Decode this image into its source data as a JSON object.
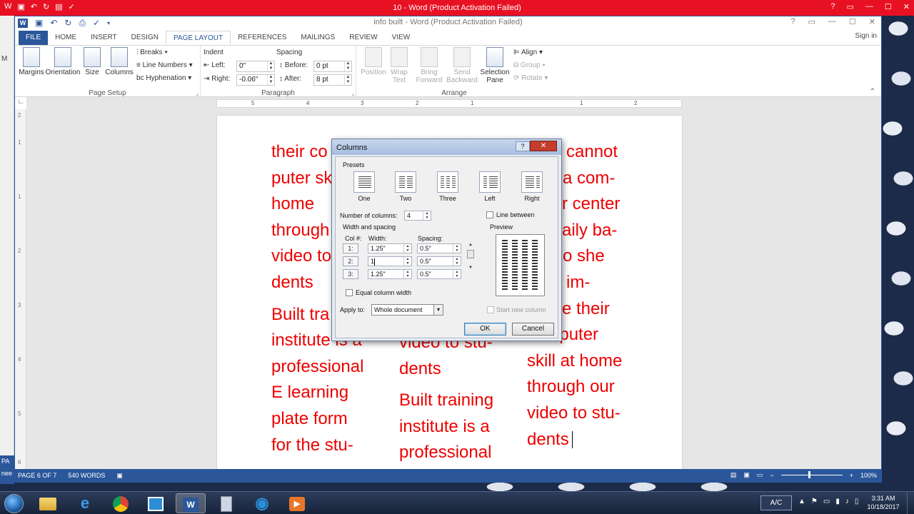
{
  "back_window": {
    "title": "10 -  Word (Product Activation Failed)",
    "left_labels": [
      "M",
      "PA",
      "nee"
    ],
    "colors": {
      "titlebar": "#e81123"
    }
  },
  "window": {
    "title": "info built - Word (Product Activation Failed)",
    "signin": "Sign in",
    "controls": {
      "help": "?",
      "restore_ribbon": "▭",
      "minimize": "—",
      "maximize": "☐",
      "close": "✕"
    }
  },
  "tabs": [
    "FILE",
    "HOME",
    "INSERT",
    "DESIGN",
    "PAGE LAYOUT",
    "REFERENCES",
    "MAILINGS",
    "REVIEW",
    "VIEW"
  ],
  "active_tab": "PAGE LAYOUT",
  "ribbon": {
    "page_setup": {
      "label": "Page Setup",
      "margins": "Margins",
      "orientation": "Orientation",
      "size": "Size",
      "columns": "Columns",
      "breaks": "Breaks",
      "line_numbers": "Line Numbers",
      "hyphenation": "Hyphenation"
    },
    "paragraph": {
      "label": "Paragraph",
      "indent": "Indent",
      "spacing": "Spacing",
      "left_label": "Left:",
      "left_value": "0\"",
      "right_label": "Right:",
      "right_value": "-0.06\"",
      "before_label": "Before:",
      "before_value": "0 pt",
      "after_label": "After:",
      "after_value": "8 pt"
    },
    "arrange": {
      "label": "Arrange",
      "position": "Position",
      "wrap_text_1": "Wrap",
      "wrap_text_2": "Text",
      "bring_forward_1": "Bring",
      "bring_forward_2": "Forward",
      "send_backward_1": "Send",
      "send_backward_2": "Backward",
      "selection_pane_1": "Selection",
      "selection_pane_2": "Pane",
      "align": "Align",
      "group": "Group",
      "rotate": "Rotate"
    }
  },
  "ruler": {
    "numbers": [
      "5",
      "4",
      "3",
      "2",
      "1",
      "1",
      "2"
    ],
    "vertical": [
      "2",
      "1",
      "1",
      "2",
      "3",
      "4",
      "5",
      "6",
      "7",
      "8"
    ]
  },
  "document": {
    "col1": [
      "their co",
      "puter sk",
      "home",
      "through",
      "video to",
      "dents",
      "Built tra",
      "institute is a",
      "professional",
      "E learning",
      "plate form",
      "for the stu-"
    ],
    "col2": [
      "video to stu-",
      "dents",
      "Built training",
      "institute is a",
      "professional"
    ],
    "col3": [
      "cannot",
      "a com-",
      "r center",
      "aily ba-",
      "o she",
      "im-",
      "e their",
      "computer",
      "skill at home",
      "through our",
      "video to stu-",
      "dents"
    ]
  },
  "dialog": {
    "title": "Columns",
    "help": "?",
    "close": "✕",
    "presets_label": "Presets",
    "presets": [
      "One",
      "Two",
      "Three",
      "Left",
      "Right"
    ],
    "number_of_columns_label": "Number of columns:",
    "number_of_columns": "4",
    "line_between": "Line between",
    "width_spacing_label": "Width and spacing",
    "preview_label": "Preview",
    "col_header": "Col #:",
    "width_header": "Width:",
    "spacing_header": "Spacing:",
    "rows": [
      {
        "col": "1:",
        "width": "1.25\"",
        "spacing": "0.5\""
      },
      {
        "col": "2:",
        "width": "1",
        "spacing": "0.5\""
      },
      {
        "col": "3:",
        "width": "1.25\"",
        "spacing": "0.5\""
      }
    ],
    "equal_column_width": "Equal column width",
    "apply_to_label": "Apply to:",
    "apply_to": "Whole document",
    "start_new_column": "Start new column",
    "ok": "OK",
    "cancel": "Cancel"
  },
  "status": {
    "page": "PAGE 6 OF 7",
    "words": "540 WORDS",
    "zoom": "100%",
    "minus": "−",
    "plus": "+"
  },
  "taskbar": {
    "apps": [
      "file-explorer",
      "internet-explorer",
      "chrome",
      "snipping-tool",
      "word",
      "calculator",
      "ie-browser",
      "media-player"
    ],
    "ac_label": "A/C",
    "time": "3:31 AM",
    "date": "10/18/2017"
  }
}
